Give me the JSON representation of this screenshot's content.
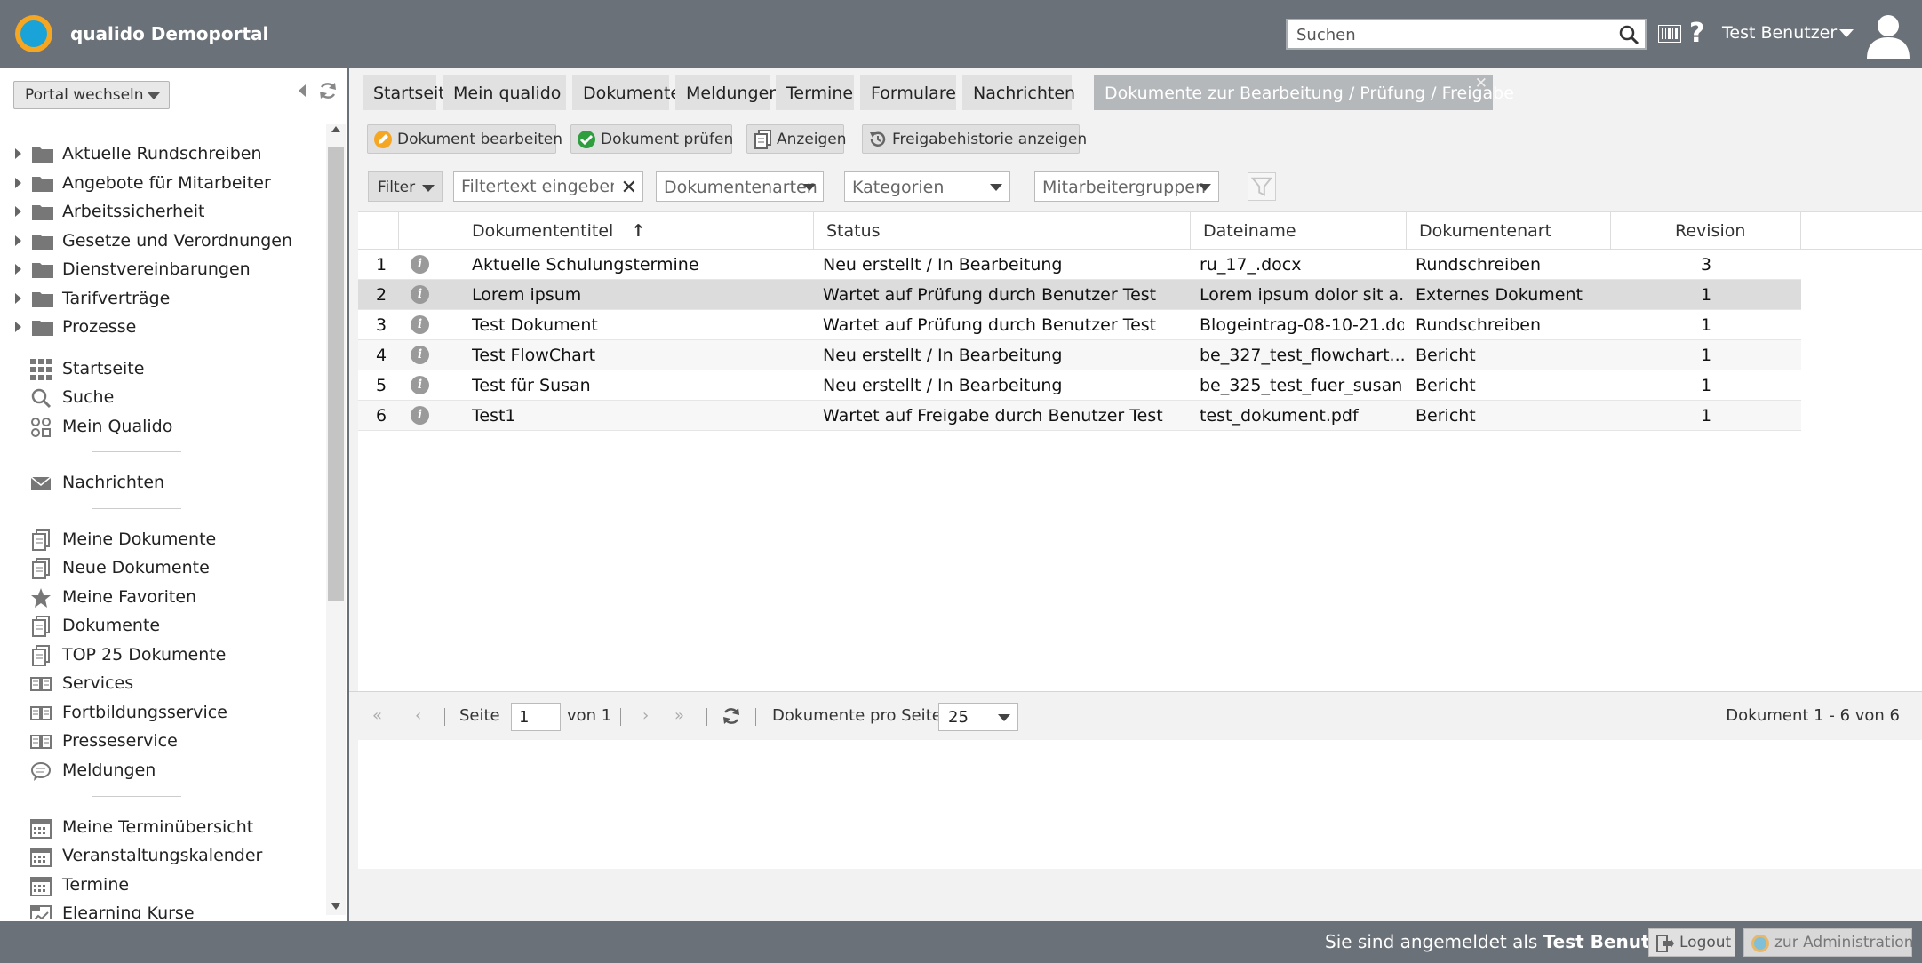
{
  "header": {
    "app_title": "qualido Demoportal",
    "search_placeholder": "Suchen",
    "help": "?",
    "user_name": "Test Benutzer"
  },
  "sidebar": {
    "portal_switch": "Portal wechseln",
    "tree": [
      "Aktuelle Rundschreiben",
      "Angebote für Mitarbeiter",
      "Arbeitssicherheit",
      "Gesetze und Verordnungen",
      "Dienstvereinbarungen",
      "Tarifverträge",
      "Prozesse"
    ],
    "nav": [
      {
        "label": "Startseite",
        "icon": "grid-icon"
      },
      {
        "label": "Suche",
        "icon": "search-icon"
      },
      {
        "label": "Mein Qualido",
        "icon": "apps-icon"
      },
      {
        "label": "Nachrichten",
        "icon": "envelope-icon"
      },
      {
        "label": "Meine Dokumente",
        "icon": "documents-icon"
      },
      {
        "label": "Neue Dokumente",
        "icon": "documents-icon"
      },
      {
        "label": "Meine Favoriten",
        "icon": "star-icon"
      },
      {
        "label": "Dokumente",
        "icon": "documents-icon"
      },
      {
        "label": "TOP 25 Dokumente",
        "icon": "documents-icon"
      },
      {
        "label": "Services",
        "icon": "book-icon"
      },
      {
        "label": "Fortbildungsservice",
        "icon": "book-icon"
      },
      {
        "label": "Presseservice",
        "icon": "book-icon"
      },
      {
        "label": "Meldungen",
        "icon": "speech-bubble-icon"
      },
      {
        "label": "Meine Terminübersicht",
        "icon": "calendar-icon"
      },
      {
        "label": "Veranstaltungskalender",
        "icon": "calendar-icon"
      },
      {
        "label": "Termine",
        "icon": "calendar-icon"
      },
      {
        "label": "Elearning Kurse",
        "icon": "elearning-icon"
      }
    ]
  },
  "tabs": [
    "Startseite",
    "Mein qualido",
    "Dokumente",
    "Meldungen",
    "Termine",
    "Formulare",
    "Nachrichten",
    "Dokumente zur Bearbeitung / Prüfung / Freigabe"
  ],
  "toolbar": {
    "edit": "Dokument bearbeiten",
    "check": "Dokument prüfen",
    "show": "Anzeigen",
    "history": "Freigabehistorie anzeigen"
  },
  "filters": {
    "filter": "Filter",
    "text_placeholder": "Filtertext eingeben",
    "doctype": "Dokumentenarten",
    "categories": "Kategorien",
    "groups": "Mitarbeitergruppen"
  },
  "table": {
    "columns": [
      "Dokumententitel",
      "Status",
      "Dateiname",
      "Dokumentenart",
      "Revision"
    ],
    "sort_indicator": "↑",
    "rows": [
      {
        "n": "1",
        "title": "Aktuelle Schulungstermine",
        "status": "Neu erstellt / In Bearbeitung",
        "file": "ru_17_.docx",
        "type": "Rundschreiben",
        "rev": "3"
      },
      {
        "n": "2",
        "title": "Lorem ipsum",
        "status": "Wartet auf Prüfung durch Benutzer Test",
        "file": "Lorem ipsum dolor sit a...",
        "type": "Externes Dokument",
        "rev": "1"
      },
      {
        "n": "3",
        "title": "Test Dokument",
        "status": "Wartet auf Prüfung durch Benutzer Test",
        "file": "Blogeintrag-08-10-21.do...",
        "type": "Rundschreiben",
        "rev": "1"
      },
      {
        "n": "4",
        "title": "Test FlowChart",
        "status": "Neu erstellt / In Bearbeitung",
        "file": "be_327_test_flowchart....",
        "type": "Bericht",
        "rev": "1"
      },
      {
        "n": "5",
        "title": "Test für Susan",
        "status": "Neu erstellt / In Bearbeitung",
        "file": "be_325_test_fuer_susan...",
        "type": "Bericht",
        "rev": "1"
      },
      {
        "n": "6",
        "title": "Test1",
        "status": "Wartet auf Freigabe durch Benutzer Test",
        "file": "test_dokument.pdf",
        "type": "Bericht",
        "rev": "1"
      }
    ]
  },
  "pager": {
    "page_label": "Seite",
    "page": "1",
    "of": "von 1",
    "per_page_label": "Dokumente pro Seite:",
    "per_page": "25",
    "summary": "Dokument 1 - 6 von 6"
  },
  "footer": {
    "login_prefix": "Sie sind angemeldet als",
    "login_user": "Test Benutzer",
    "logout": "Logout",
    "admin": "zur Administration"
  },
  "colors": {
    "header_bg": "#6b7178",
    "accent_orange": "#f5a623",
    "accent_blue": "#1aa3d8",
    "check_green": "#2e9e3e"
  }
}
